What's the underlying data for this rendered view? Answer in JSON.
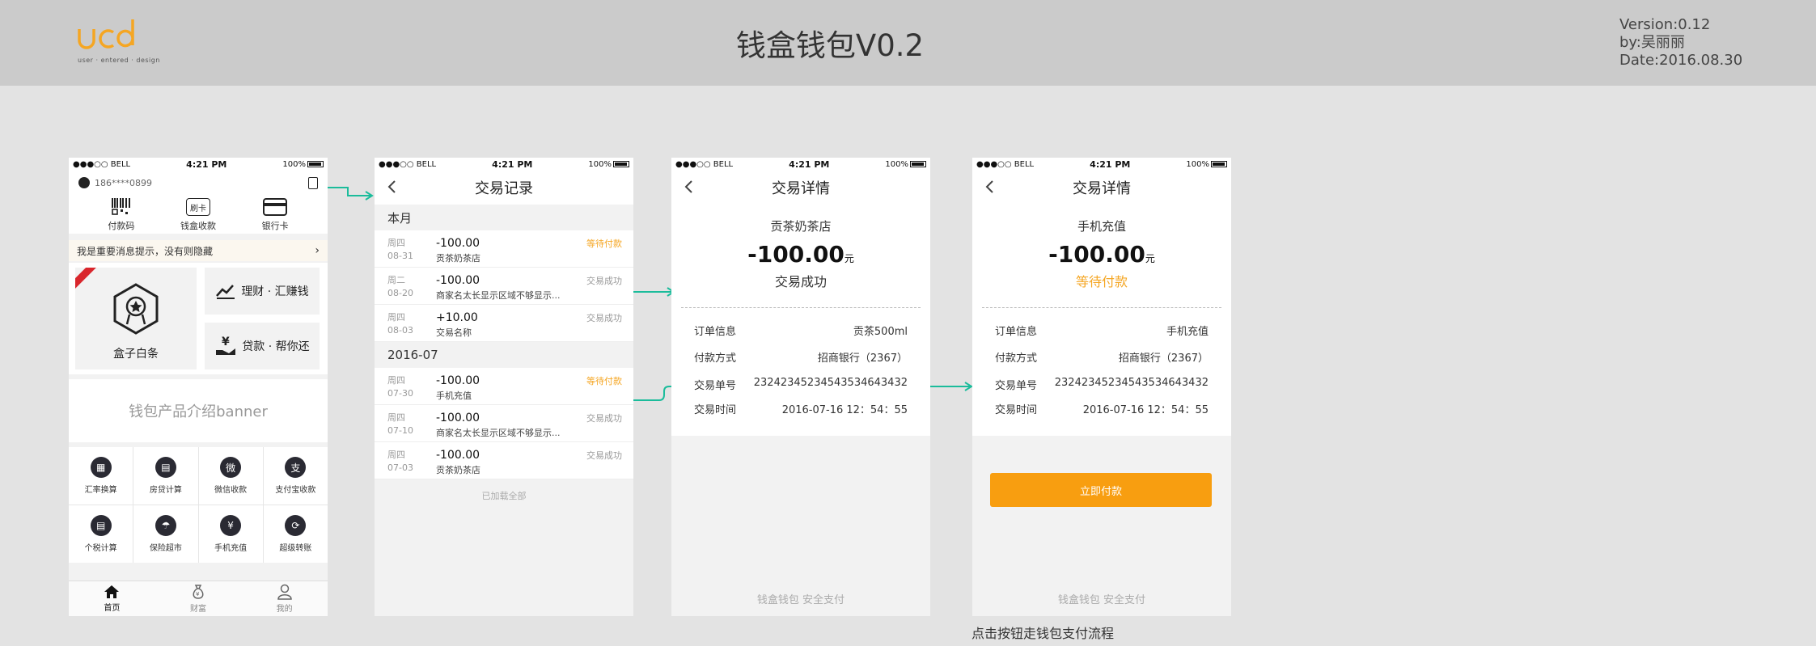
{
  "header": {
    "logo_text": "ucd",
    "logo_sub": "user · entered · design",
    "title": "钱盒钱包V0.2",
    "version": "Version:0.12",
    "author": "by:吴丽丽",
    "date": "Date:2016.08.30"
  },
  "status": {
    "carrier": "●●●○○ BELL",
    "time": "4:21 PM",
    "battery": "100%"
  },
  "home": {
    "phone": "186****0899",
    "top_actions": [
      "付款码",
      "钱盒收款",
      "银行卡"
    ],
    "card_icon_text": "刷卡",
    "notice": "我是重要消息提示，没有则隐藏",
    "notice_arrow": "›",
    "big_card": "盒子白条",
    "small_cards": [
      "理财 · 汇赚钱",
      "贷款 · 帮你还"
    ],
    "banner": "钱包产品介绍banner",
    "grid": [
      {
        "label": "汇率换算",
        "icon": "▦"
      },
      {
        "label": "房贷计算",
        "icon": "▤"
      },
      {
        "label": "微信收款",
        "icon": "微"
      },
      {
        "label": "支付宝收款",
        "icon": "支"
      },
      {
        "label": "个税计算",
        "icon": "▤"
      },
      {
        "label": "保险超市",
        "icon": "☂"
      },
      {
        "label": "手机充值",
        "icon": "¥"
      },
      {
        "label": "超级转账",
        "icon": "⟳"
      }
    ],
    "tabs": [
      "首页",
      "财富",
      "我的"
    ]
  },
  "records": {
    "title": "交易记录",
    "sections": [
      {
        "label": "本月",
        "items": [
          {
            "week": "周四",
            "date": "08-31",
            "amount": "-100.00",
            "name": "贡茶奶茶店",
            "status": "等待付款",
            "pending": true
          },
          {
            "week": "周二",
            "date": "08-20",
            "amount": "-100.00",
            "name": "商家名太长显示区域不够显示...",
            "status": "交易成功",
            "pending": false
          },
          {
            "week": "周四",
            "date": "08-03",
            "amount": "+10.00",
            "name": "交易名称",
            "status": "交易成功",
            "pending": false
          }
        ]
      },
      {
        "label": "2016-07",
        "items": [
          {
            "week": "周四",
            "date": "07-30",
            "amount": "-100.00",
            "name": "手机充值",
            "status": "等待付款",
            "pending": true
          },
          {
            "week": "周四",
            "date": "07-10",
            "amount": "-100.00",
            "name": "商家名太长显示区域不够显示...",
            "status": "交易成功",
            "pending": false
          },
          {
            "week": "周四",
            "date": "07-03",
            "amount": "-100.00",
            "name": "贡茶奶茶店",
            "status": "交易成功",
            "pending": false
          }
        ]
      }
    ],
    "loaded": "已加载全部"
  },
  "detail1": {
    "title": "交易详情",
    "merchant": "贡茶奶茶店",
    "amount": "-100.00",
    "unit": "元",
    "status": "交易成功",
    "rows": [
      {
        "k": "订单信息",
        "v": "贡茶500ml"
      },
      {
        "k": "付款方式",
        "v": "招商银行（2367）"
      },
      {
        "k": "交易单号",
        "v": "23242345234543534643432"
      },
      {
        "k": "交易时间",
        "v": "2016-07-16 12：54：55"
      }
    ],
    "footer": "钱盒钱包  安全支付"
  },
  "detail2": {
    "title": "交易详情",
    "merchant": "手机充值",
    "amount": "-100.00",
    "unit": "元",
    "status": "等待付款",
    "rows": [
      {
        "k": "订单信息",
        "v": "手机充值"
      },
      {
        "k": "付款方式",
        "v": "招商银行（2367）"
      },
      {
        "k": "交易单号",
        "v": "23242345234543534643432"
      },
      {
        "k": "交易时间",
        "v": "2016-07-16 12：54：55"
      }
    ],
    "pay_button": "立即付款",
    "footer": "钱盒钱包  安全支付"
  },
  "caption": "点击按钮走钱包支付流程",
  "colors": {
    "accent": "#f89e10",
    "pending": "#f5a623",
    "arrow": "#1bbc9b",
    "logo": "#f5a623"
  }
}
